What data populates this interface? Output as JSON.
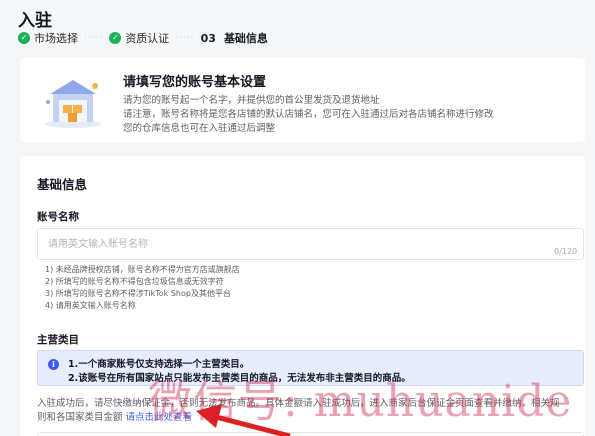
{
  "page": {
    "title": "入驻"
  },
  "steps": [
    {
      "label": "市场选择",
      "status": "done"
    },
    {
      "label": "资质认证",
      "status": "done"
    },
    {
      "number": "03",
      "label": "基础信息",
      "status": "current"
    }
  ],
  "banner": {
    "title": "请填写您的账号基本设置",
    "lines": [
      "请为您的账号起一个名字，并提供您的首公里发货及退货地址",
      "请注意，账号名称将是您各店铺的默认店铺名，您可在入驻通过后对各店铺名称进行修改",
      "您的仓库信息也可在入驻通过后调整"
    ]
  },
  "form": {
    "section_title": "基础信息",
    "account_name": {
      "label": "账号名称",
      "placeholder": "请用英文输入账号名称",
      "count": "0/120",
      "rules": [
        "1) 未经品牌授权店铺，账号名称不得为官方店或旗舰店",
        "2) 所填写的账号名称不得包含垃圾信息或无效字符",
        "3) 所填写的账号名称不得涉TikTok Shop及其他平台",
        "4) 请用英文输入账号名称"
      ]
    },
    "category": {
      "label": "主营类目",
      "notice": [
        "1.一个商家账号仅支持选择一个主营类目。",
        "2.该账号在所有国家站点只能发布主营类目的商品，无法发布非主营类目的商品。"
      ],
      "info_line1": "入驻成功后，请尽快缴纳保证金，否则无法发布商品。具体金额请入驻成功后，进入商家后台保证金页面查看并缴纳，相关规",
      "info_line2": "则和各国家类目金额",
      "info_link": "请点击此处查看"
    }
  },
  "overlay": {
    "watermark": "微信号: muhuanide"
  },
  "colors": {
    "success": "#19b35a",
    "primary": "#3d5afe",
    "notice_bg": "#e8ecff",
    "arrow": "#e02020"
  }
}
